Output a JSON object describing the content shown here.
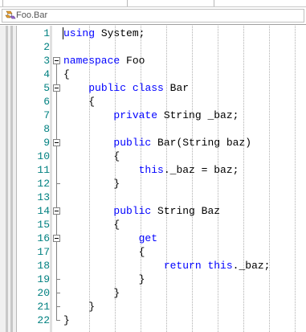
{
  "navbar": {
    "label": "Foo.Bar",
    "icon": "class-icon"
  },
  "colors": {
    "keyword": "#0000ff",
    "line_number": "#008080",
    "text": "#000000"
  },
  "editor": {
    "lines": [
      {
        "n": "1",
        "code": [
          [
            "kw",
            "using"
          ],
          [
            "t",
            " System;"
          ]
        ]
      },
      {
        "n": "2",
        "code": []
      },
      {
        "n": "3",
        "code": [
          [
            "kw",
            "namespace"
          ],
          [
            "t",
            " Foo"
          ]
        ],
        "fold": true
      },
      {
        "n": "4",
        "code": [
          [
            "t",
            "{"
          ]
        ]
      },
      {
        "n": "5",
        "code": [
          [
            "t",
            "    "
          ],
          [
            "kw",
            "public"
          ],
          [
            "t",
            " "
          ],
          [
            "kw",
            "class"
          ],
          [
            "t",
            " Bar"
          ]
        ],
        "fold": true
      },
      {
        "n": "6",
        "code": [
          [
            "t",
            "    {"
          ]
        ]
      },
      {
        "n": "7",
        "code": [
          [
            "t",
            "        "
          ],
          [
            "kw",
            "private"
          ],
          [
            "t",
            " String _baz;"
          ]
        ]
      },
      {
        "n": "8",
        "code": []
      },
      {
        "n": "9",
        "code": [
          [
            "t",
            "        "
          ],
          [
            "kw",
            "public"
          ],
          [
            "t",
            " Bar(String baz)"
          ]
        ],
        "fold": true
      },
      {
        "n": "10",
        "code": [
          [
            "t",
            "        {"
          ]
        ]
      },
      {
        "n": "11",
        "code": [
          [
            "t",
            "            "
          ],
          [
            "kw",
            "this"
          ],
          [
            "t",
            "._baz = baz;"
          ]
        ]
      },
      {
        "n": "12",
        "code": [
          [
            "t",
            "        }"
          ]
        ]
      },
      {
        "n": "13",
        "code": []
      },
      {
        "n": "14",
        "code": [
          [
            "t",
            "        "
          ],
          [
            "kw",
            "public"
          ],
          [
            "t",
            " String Baz"
          ]
        ],
        "fold": true
      },
      {
        "n": "15",
        "code": [
          [
            "t",
            "        {"
          ]
        ]
      },
      {
        "n": "16",
        "code": [
          [
            "t",
            "            "
          ],
          [
            "kw",
            "get"
          ]
        ],
        "fold": true
      },
      {
        "n": "17",
        "code": [
          [
            "t",
            "            {"
          ]
        ]
      },
      {
        "n": "18",
        "code": [
          [
            "t",
            "                "
          ],
          [
            "kw",
            "return"
          ],
          [
            "t",
            " "
          ],
          [
            "kw",
            "this"
          ],
          [
            "t",
            "._baz;"
          ]
        ]
      },
      {
        "n": "19",
        "code": [
          [
            "t",
            "            }"
          ]
        ]
      },
      {
        "n": "20",
        "code": [
          [
            "t",
            "        }"
          ]
        ]
      },
      {
        "n": "21",
        "code": [
          [
            "t",
            "    }"
          ]
        ]
      },
      {
        "n": "22",
        "code": [
          [
            "t",
            "}"
          ]
        ]
      }
    ]
  }
}
